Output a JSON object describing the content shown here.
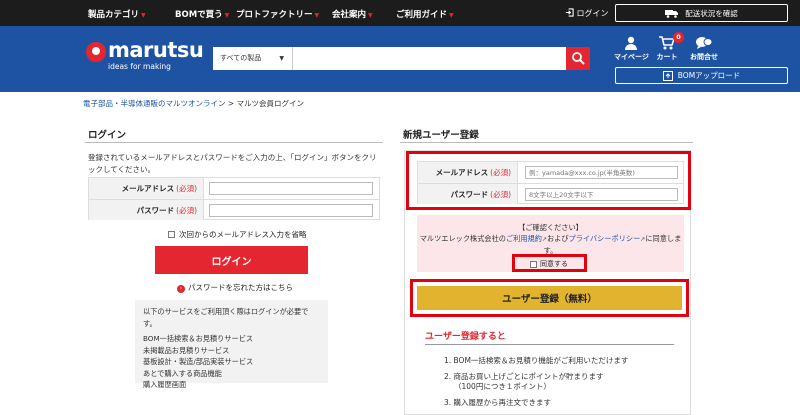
{
  "topnav": {
    "items": [
      "製品カテゴリ",
      "BOMで買う",
      "プロトファクトリー",
      "会社案内",
      "ご利用ガイド"
    ],
    "login": "ログイン",
    "track": "配送状況を確認"
  },
  "header": {
    "logo_name": "marutsu",
    "logo_tag": "ideas for making",
    "search_category": "すべての製品",
    "search_placeholder": "",
    "mypage": "マイページ",
    "cart": "カート",
    "cart_count": "0",
    "contact": "お問合せ",
    "bom_upload": "BOMアップロード"
  },
  "breadcrumb": {
    "home": "電子部品・半導体通販のマルツオンライン",
    "sep": " > ",
    "current": "マルツ会員ログイン"
  },
  "login": {
    "title": "ログイン",
    "intro": "登録されているメールアドレスとパスワードをご入力の上、「ログイン」ボタンをクリックしてください。",
    "email_label": "メールアドレス",
    "password_label": "パスワード",
    "required": "(必須)",
    "remember": "次回からのメールアドレス入力を省略",
    "button": "ログイン",
    "forgot": "パスワードを忘れた方はこちら",
    "services_head": "以下のサービスをご利用頂く際はログインが必要です。",
    "services": [
      "BOM一括検索＆お見積りサービス",
      "未掲載品お見積りサービス",
      "基板設計・製造/部品実装サービス",
      "あとで購入する商品機能",
      "購入履歴画面"
    ]
  },
  "register": {
    "title": "新規ユーザー登録",
    "email_label": "メールアドレス",
    "email_placeholder": "例：yamada@xxx.co.jp(半角英数)",
    "password_label": "パスワード",
    "password_placeholder": "8文字以上20文字以下",
    "required": "(必須)",
    "confirm_head": "【ご確認ください】",
    "confirm_pre": "マルツエレック株式会社の",
    "terms": "ご利用規約",
    "and": "および",
    "privacy": "プライバシーポリシー",
    "confirm_post": "に同意します。",
    "agree": "同意する",
    "button": "ユーザー登録（無料）",
    "benefit_title": "ユーザー登録すると",
    "benefit1": "1. BOM一括検索＆お見積り機能がご利用いただけます",
    "benefit2a": "2. 商品お買い上げごとにポイントが貯まります",
    "benefit2b": "（100円につき１ポイント）",
    "benefit3": "3. 購入履歴から再注文できます"
  },
  "colors": {
    "brand_blue": "#1e53a3",
    "accent_red": "#e3262f",
    "register_yellow": "#e2b32e"
  }
}
